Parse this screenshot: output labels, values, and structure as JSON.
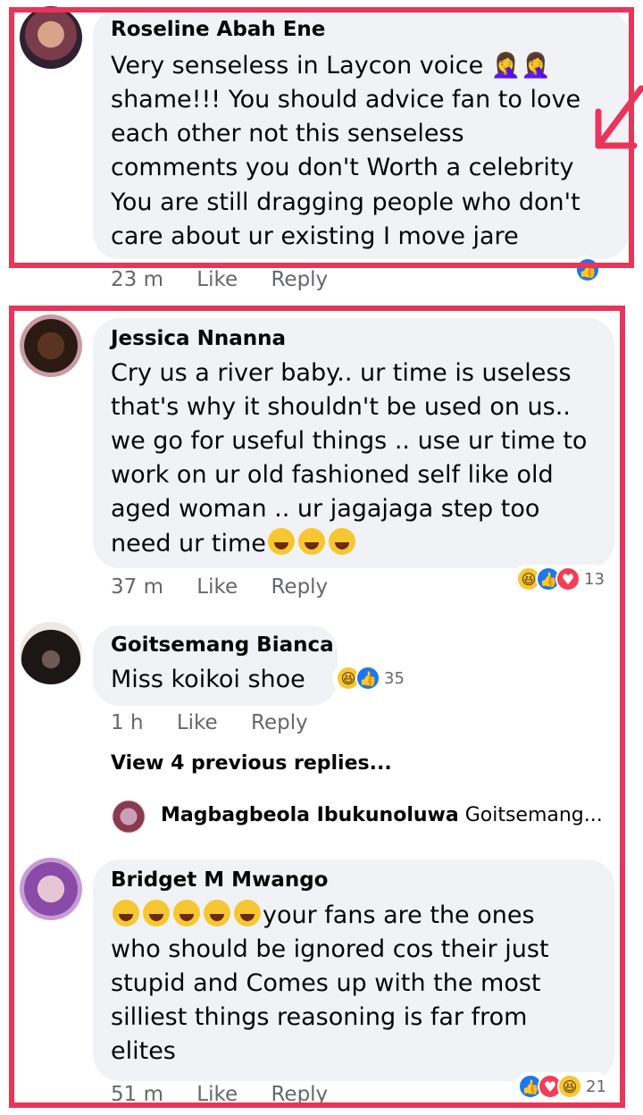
{
  "comments": [
    {
      "author": "Roseline Abah Ene",
      "lines": [
        "Very senseless in Laycon voice 🤦‍♀️🤦‍♀️",
        "shame!!! You should advice fan to love",
        "each other not this senseless",
        "comments you don't Worth a celebrity",
        "You are still dragging people who don't",
        "care about ur existing I move jare"
      ],
      "time": "23 m",
      "like": "Like",
      "reply": "Reply"
    },
    {
      "author": "Jessica Nnanna",
      "lines": [
        "Cry us a river baby.. ur time is useless",
        "that's why it shouldn't be used on us..",
        "we go for useful things .. use ur time to",
        "work on ur old fashioned self like old",
        "aged woman .. ur jagajaga step too",
        "need ur time"
      ],
      "time": "37 m",
      "like": "Like",
      "reply": "Reply",
      "reaction_count": "13"
    },
    {
      "author": "Goitsemang Bianca",
      "lines": [
        "Miss koikoi shoe"
      ],
      "time": "1 h",
      "like": "Like",
      "reply": "Reply",
      "reaction_count": "35"
    },
    {
      "author": "Bridget M Mwango",
      "lines": [
        "your fans are the ones",
        "who should be ignored cos their just",
        "stupid and Comes up with the most",
        "silliest things reasoning is far from",
        "elites"
      ],
      "time": "51 m",
      "like": "Like",
      "reply": "Reply",
      "reaction_count": "21"
    }
  ],
  "view_previous": "View 4 previous replies...",
  "reply_preview": {
    "author": "Magbagbeola Ibukunoluwa",
    "text": "Goitsemang..."
  },
  "colors": {
    "highlight_border": "#e8355a",
    "bubble": "#f0f2f5",
    "meta_text": "#65676b"
  }
}
